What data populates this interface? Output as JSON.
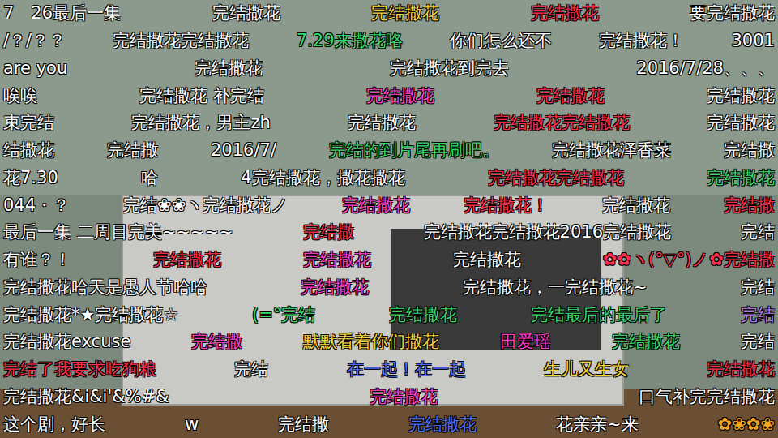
{
  "player": {
    "view": "video-with-danmaku"
  },
  "danmaku_rows": [
    {
      "comments": [
        {
          "text": "7　26最后一集",
          "color": "#ffffff"
        },
        {
          "text": "完结撒花",
          "color": "#ffffff"
        },
        {
          "text": "完结撒花",
          "color": "#f5d23a"
        },
        {
          "text": "完结撒花",
          "color": "#ff2d4b"
        },
        {
          "text": "要完结撒花",
          "color": "#ffffff"
        }
      ]
    },
    {
      "comments": [
        {
          "text": "/？/？？",
          "color": "#ffffff"
        },
        {
          "text": "完结撒花完结撒花",
          "color": "#ffffff"
        },
        {
          "text": "7.29来撒花咯",
          "color": "#3ad76a"
        },
        {
          "text": "你们怎么还不",
          "color": "#ffffff"
        },
        {
          "text": "完结撒花！",
          "color": "#ffffff"
        },
        {
          "text": "3001",
          "color": "#ffffff"
        }
      ]
    },
    {
      "comments": [
        {
          "text": "are you",
          "color": "#ffffff"
        },
        {
          "text": "完结撒花",
          "color": "#ffffff"
        },
        {
          "text": "完结撒花到完去",
          "color": "#ffffff"
        },
        {
          "text": "2016/7/28、、、",
          "color": "#ffffff"
        }
      ]
    },
    {
      "comments": [
        {
          "text": "唉唉",
          "color": "#ffffff"
        },
        {
          "text": "完结撒花 补完结",
          "color": "#ffffff"
        },
        {
          "text": "完结撒花",
          "color": "#ff3cc8"
        },
        {
          "text": "完结撒花",
          "color": "#ff2d4b"
        },
        {
          "text": "完结撒花",
          "color": "#ffffff"
        }
      ]
    },
    {
      "comments": [
        {
          "text": "束完结",
          "color": "#ffffff"
        },
        {
          "text": "完结撒花，男主zh",
          "color": "#ffffff"
        },
        {
          "text": "完结撒花",
          "color": "#ffffff"
        },
        {
          "text": "完结撒花完结撒花",
          "color": "#ff2d4b"
        },
        {
          "text": "完结撒花",
          "color": "#ffffff"
        }
      ]
    },
    {
      "comments": [
        {
          "text": "结撒花",
          "color": "#ffffff"
        },
        {
          "text": "完结撒",
          "color": "#ffffff"
        },
        {
          "text": "2016/7/",
          "color": "#ffffff"
        },
        {
          "text": "完结的到片尾再刷吧。",
          "color": "#3ad76a"
        },
        {
          "text": "完结撒花泽香菜",
          "color": "#ffffff"
        },
        {
          "text": "完结撒",
          "color": "#ffffff"
        }
      ]
    },
    {
      "comments": [
        {
          "text": "花7.30",
          "color": "#ffffff"
        },
        {
          "text": "哈",
          "color": "#ffffff"
        },
        {
          "text": "4完结撒花，撒花撒花",
          "color": "#ffffff"
        },
        {
          "text": "完结撒花完结撒花",
          "color": "#ff2d4b"
        },
        {
          "text": "完结撒花",
          "color": "#3ad76a"
        }
      ]
    },
    {
      "comments": [
        {
          "text": "044・？",
          "color": "#ffffff"
        },
        {
          "text": "完结❀❀ヽ完结撒花ノ",
          "color": "#ffffff"
        },
        {
          "text": "完结撒花",
          "color": "#ff3cc8"
        },
        {
          "text": "完结撒花！",
          "color": "#ff2d4b"
        },
        {
          "text": "完结撒花",
          "color": "#ffffff"
        },
        {
          "text": "完结撒",
          "color": "#ff2d4b"
        }
      ]
    },
    {
      "comments": [
        {
          "text": "最后一集 二周目完美~~~~~",
          "color": "#ffffff"
        },
        {
          "text": "完结撒",
          "color": "#ff2d4b"
        },
        {
          "text": "完结撒花完结撒花2016完结撒花",
          "color": "#ffffff"
        },
        {
          "text": "完结",
          "color": "#ffffff"
        }
      ]
    },
    {
      "comments": [
        {
          "text": "有谁？！",
          "color": "#ffffff"
        },
        {
          "text": "完结撒花",
          "color": "#ff2d4b"
        },
        {
          "text": "完结撒花",
          "color": "#ff3cc8"
        },
        {
          "text": "完结撒花",
          "color": "#ffffff"
        },
        {
          "text": "✿✿ヽ(°▽°)ノ✿完结撒",
          "color": "#ff2d4b"
        }
      ]
    },
    {
      "comments": [
        {
          "text": "完结撒花哈天是愚人节哈哈",
          "color": "#ffffff"
        },
        {
          "text": "完结撒花",
          "color": "#ff3cc8"
        },
        {
          "text": "完结撒花，一完结撒花~",
          "color": "#ffffff"
        },
        {
          "text": "完结",
          "color": "#ffffff"
        }
      ]
    },
    {
      "comments": [
        {
          "text": "完结撒花*★完结撒花☆",
          "color": "#ffffff"
        },
        {
          "text": "(=°完结",
          "color": "#3ad76a"
        },
        {
          "text": "完结撒花",
          "color": "#3ad76a"
        },
        {
          "text": "完结最后的最后了",
          "color": "#3ad76a"
        },
        {
          "text": "完结",
          "color": "#b57ce6"
        }
      ]
    },
    {
      "comments": [
        {
          "text": "完结撒花excuse",
          "color": "#ffffff"
        },
        {
          "text": "完结撒",
          "color": "#ff3cc8"
        },
        {
          "text": "默默看着你们撒花",
          "color": "#f5d23a"
        },
        {
          "text": "田爱瑶",
          "color": "#ff3cc8"
        },
        {
          "text": "完结撒花",
          "color": "#3ad76a"
        },
        {
          "text": "完结",
          "color": "#ffffff"
        }
      ]
    },
    {
      "comments": [
        {
          "text": "完结了我要求吃狗粮",
          "color": "#ff2d4b"
        },
        {
          "text": "完结",
          "color": "#ffffff"
        },
        {
          "text": "在一起！在一起",
          "color": "#4a6cf7"
        },
        {
          "text": "生儿又生女",
          "color": "#f5d23a"
        },
        {
          "text": "完结撒花",
          "color": "#ff2d4b"
        }
      ]
    },
    {
      "comments": [
        {
          "text": "完结撒花&i&i'&%#&",
          "color": "#ffffff"
        },
        {
          "text": "完结撒花",
          "color": "#ff3cc8"
        },
        {
          "text": "口气补完完结撒花",
          "color": "#ffffff"
        }
      ]
    },
    {
      "comments": [
        {
          "text": "这个剧，好长",
          "color": "#ffffff"
        },
        {
          "text": "w",
          "color": "#ffffff"
        },
        {
          "text": "完结撒",
          "color": "#ffffff"
        },
        {
          "text": "完结撒花",
          "color": "#4a6cf7"
        },
        {
          "text": "花亲亲~来",
          "color": "#ffffff"
        },
        {
          "text": "✿❀✿❀",
          "color": "#f5a623"
        }
      ]
    }
  ]
}
